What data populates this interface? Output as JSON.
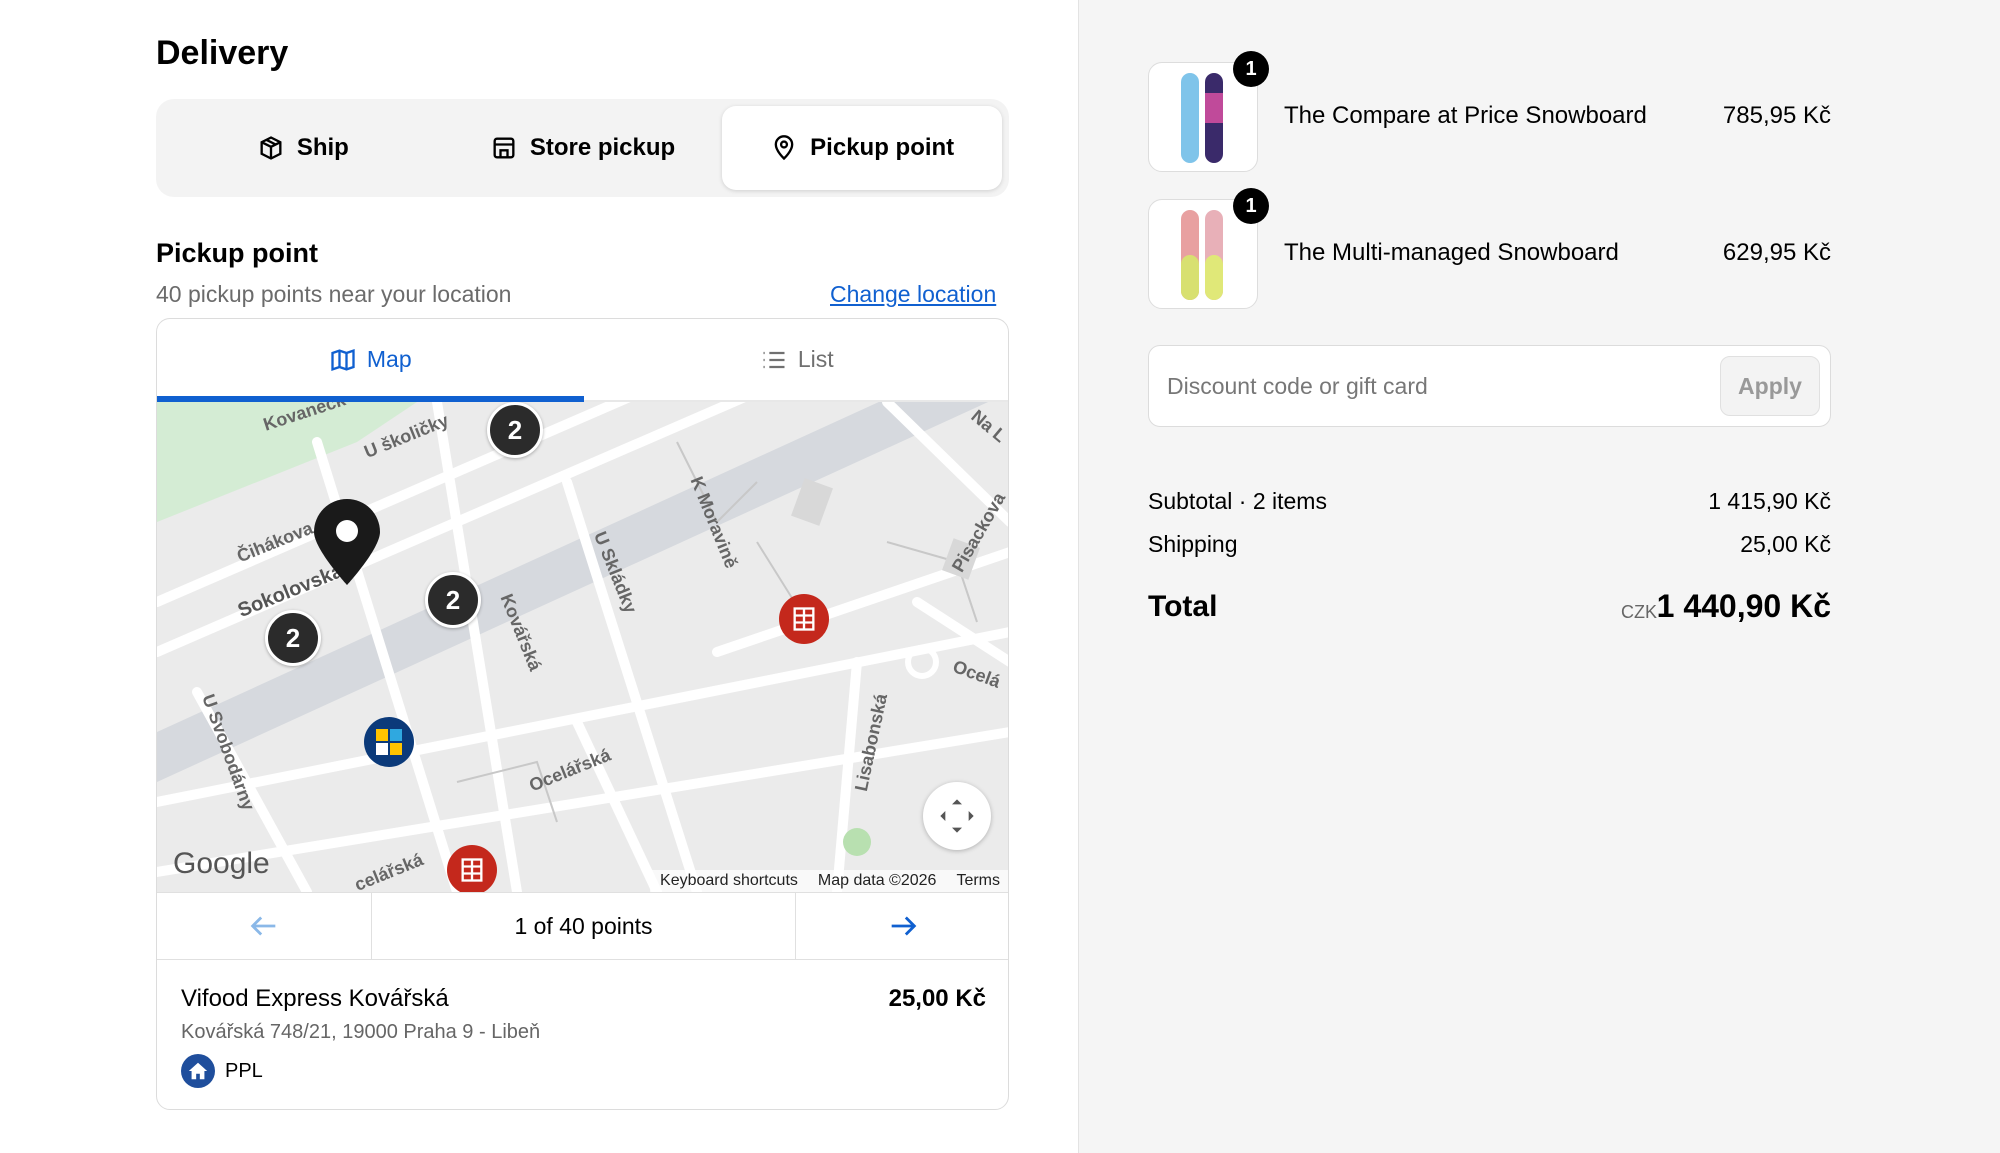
{
  "delivery": {
    "title": "Delivery",
    "methods": [
      {
        "label": "Ship",
        "icon": "package-icon"
      },
      {
        "label": "Store pickup",
        "icon": "store-icon"
      },
      {
        "label": "Pickup point",
        "icon": "location-pin-icon"
      }
    ],
    "selected": "Pickup point"
  },
  "pickup": {
    "title": "Pickup point",
    "subtitle": "40 pickup points near your location",
    "change_location": "Change location",
    "tabs": {
      "map": "Map",
      "list": "List"
    },
    "map": {
      "street_labels": [
        "Kovaneck",
        "U školičky",
        "Čihákova",
        "Sokolovská",
        "Kovářská",
        "U Skládky",
        "K Moravině",
        "Pisackova",
        "Ocelá",
        "Lisabonská",
        "Ocelářská",
        "U Svobodárny",
        "celářská",
        "Na L"
      ],
      "clusters": [
        "2",
        "2",
        "2"
      ],
      "google": "Google",
      "footer": [
        "Keyboard shortcuts",
        "Map data ©2026",
        "Terms"
      ]
    },
    "pager": "1 of 40 points",
    "location": {
      "name": "Vifood Express Kovářská",
      "price": "25,00 Kč",
      "address": "Kovářská 748/21, 19000 Praha 9 - Libeň",
      "carrier": "PPL"
    }
  },
  "cart": {
    "items": [
      {
        "name": "The Compare at Price Snowboard",
        "price": "785,95 Kč",
        "qty": "1"
      },
      {
        "name": "The Multi-managed Snowboard",
        "price": "629,95 Kč",
        "qty": "1"
      }
    ],
    "discount_placeholder": "Discount code or gift card",
    "apply": "Apply",
    "subtotal_label": "Subtotal · 2 items",
    "subtotal": "1 415,90 Kč",
    "shipping_label": "Shipping",
    "shipping": "25,00 Kč",
    "total_label": "Total",
    "currency": "CZK",
    "total": "1 440,90 Kč"
  },
  "colors": {
    "accent": "#1060d0",
    "map_bg": "#ebebeb",
    "poi_red": "#c4281c"
  }
}
